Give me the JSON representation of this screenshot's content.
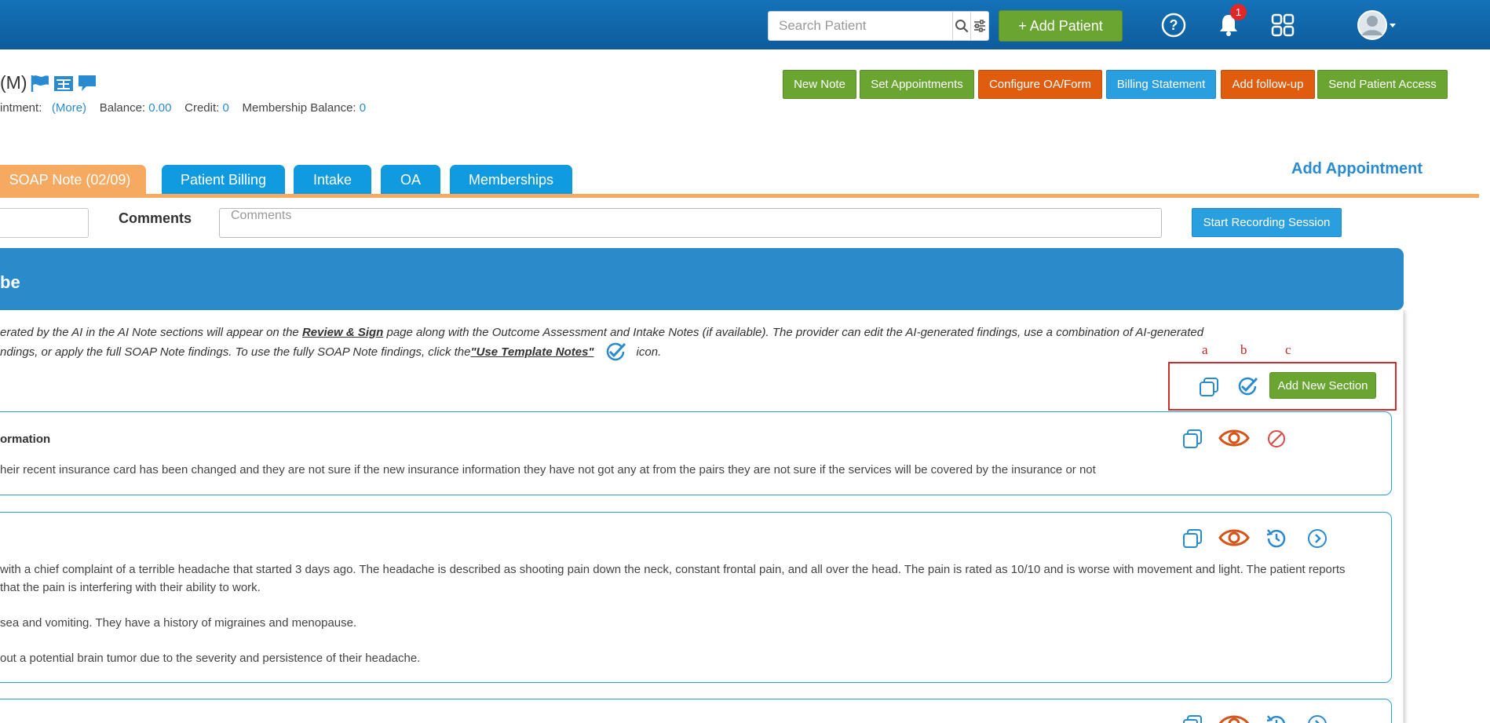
{
  "header": {
    "search_placeholder": "Search Patient",
    "add_patient_label": "+ Add Patient",
    "notification_count": "1"
  },
  "patient": {
    "name_fragment": "(M)",
    "appointment_label": "intment:",
    "more_link": "(More)",
    "balance_label": "Balance:",
    "balance_value": "0.00",
    "credit_label": "Credit:",
    "credit_value": "0",
    "membership_label": "Membership Balance:",
    "membership_value": "0"
  },
  "actions": {
    "new_note": "New Note",
    "set_appointments": "Set Appointments",
    "configure_oa": "Configure OA/Form",
    "billing_statement": "Billing Statement",
    "add_followup": "Add follow-up",
    "send_access": "Send Patient Access"
  },
  "tabs": {
    "items": [
      {
        "label": "SOAP Note (02/09)"
      },
      {
        "label": "Patient Billing"
      },
      {
        "label": "Intake"
      },
      {
        "label": "OA"
      },
      {
        "label": "Memberships"
      }
    ],
    "add_appointment": "Add Appointment"
  },
  "comments": {
    "label": "Comments",
    "placeholder": "Comments",
    "start_recording": "Start Recording Session"
  },
  "section": {
    "title": "be",
    "info_line1_a": "erated by the AI in the AI Note sections will appear on the ",
    "info_line1_link": "Review & Sign",
    "info_line1_b": " page along with the Outcome Assessment and Intake Notes (if available). The provider can edit the AI-generated findings, use a combination of AI-generated",
    "info_line2_a": "ndings, or apply the full SOAP Note findings. To use the fully SOAP Note findings, click the ",
    "info_line2_link": "\"Use Template Notes\"",
    "info_line2_b": "icon."
  },
  "toolbar": {
    "label_a": "a",
    "label_b": "b",
    "label_c": "c",
    "add_new_section": "Add New Section"
  },
  "cards": [
    {
      "title": "ormation",
      "lines": [
        "heir recent insurance card has been changed and they are not sure if the new insurance information they have not got any at from the pairs they are not sure if the services will be covered by the insurance or not"
      ]
    },
    {
      "title": "",
      "lines": [
        "with a chief complaint of a terrible headache that started 3 days ago. The headache is described as shooting pain down the neck, constant frontal pain, and all over the head. The pain is rated as 10/10 and is worse with movement and light. The patient reports",
        "that the pain is interfering with their ability to work.",
        "sea and vomiting. They have a history of migraines and menopause.",
        "out a potential brain tumor due to the severity and persistence of their headache."
      ]
    }
  ],
  "colors": {
    "topbar": "#1472b8",
    "green": "#6aa431",
    "orange": "#e05d10",
    "blue": "#2a9fe0",
    "tab_active": "#f5a961",
    "icon_blue": "#2a8ad0",
    "icon_orange": "#d4541a",
    "icon_red": "#d94a4a"
  }
}
